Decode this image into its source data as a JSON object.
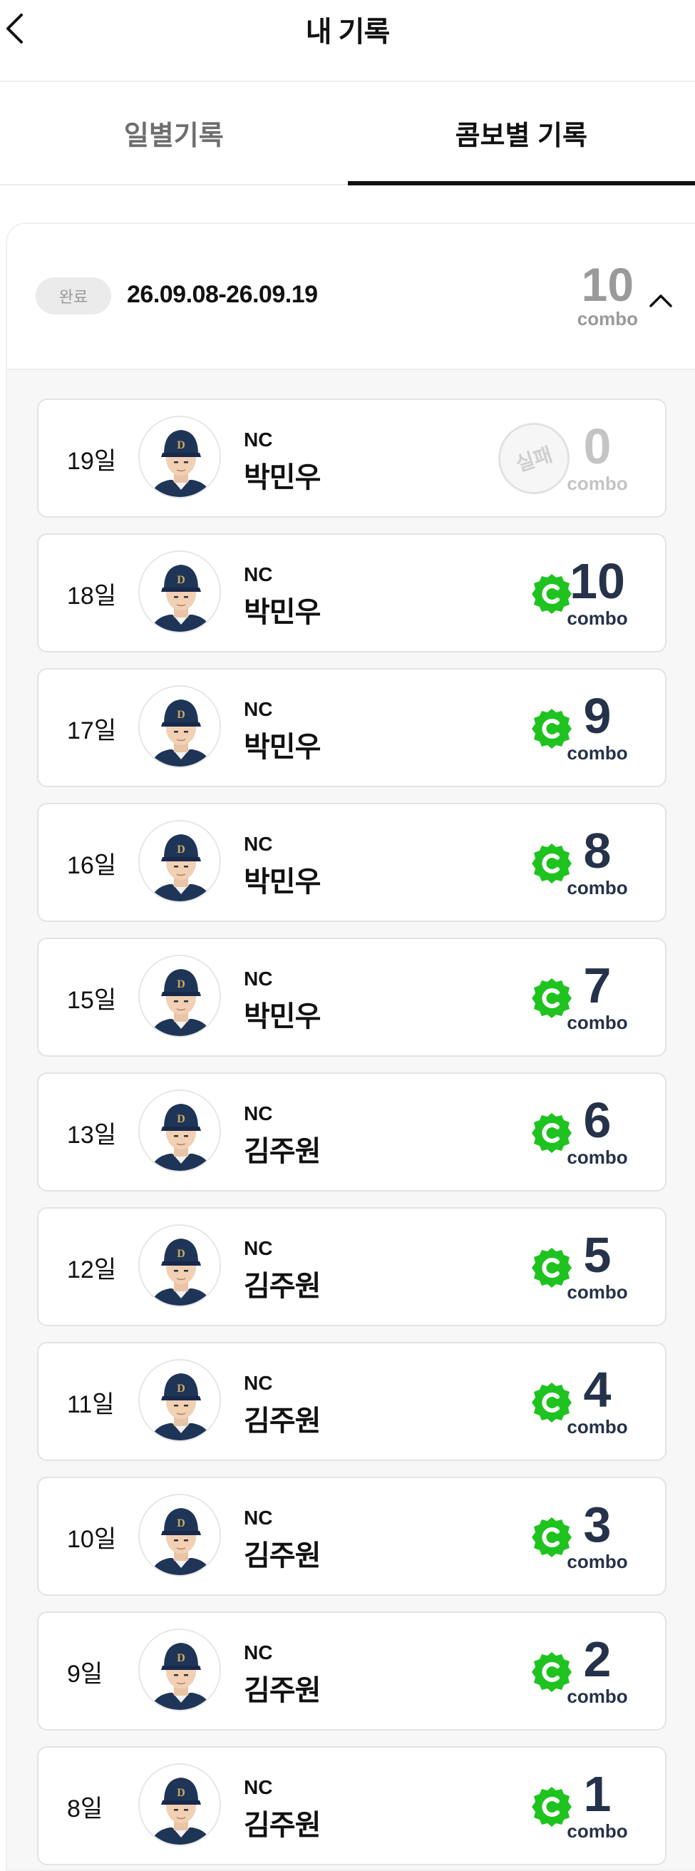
{
  "header": {
    "title": "내 기록"
  },
  "tabs": [
    {
      "label": "일별기록",
      "active": false
    },
    {
      "label": "콤보별 기록",
      "active": true
    }
  ],
  "period": {
    "status": "완료",
    "range": "26.09.08-26.09.19",
    "total_combo": "10",
    "combo_label": "combo"
  },
  "records": [
    {
      "day": "19일",
      "team": "NC",
      "player": "박민우",
      "success": false,
      "fail_label": "실패",
      "combo": "0",
      "combo_label": "combo"
    },
    {
      "day": "18일",
      "team": "NC",
      "player": "박민우",
      "success": true,
      "combo": "10",
      "combo_label": "combo"
    },
    {
      "day": "17일",
      "team": "NC",
      "player": "박민우",
      "success": true,
      "combo": "9",
      "combo_label": "combo"
    },
    {
      "day": "16일",
      "team": "NC",
      "player": "박민우",
      "success": true,
      "combo": "8",
      "combo_label": "combo"
    },
    {
      "day": "15일",
      "team": "NC",
      "player": "박민우",
      "success": true,
      "combo": "7",
      "combo_label": "combo"
    },
    {
      "day": "13일",
      "team": "NC",
      "player": "김주원",
      "success": true,
      "combo": "6",
      "combo_label": "combo"
    },
    {
      "day": "12일",
      "team": "NC",
      "player": "김주원",
      "success": true,
      "combo": "5",
      "combo_label": "combo"
    },
    {
      "day": "11일",
      "team": "NC",
      "player": "김주원",
      "success": true,
      "combo": "4",
      "combo_label": "combo"
    },
    {
      "day": "10일",
      "team": "NC",
      "player": "김주원",
      "success": true,
      "combo": "3",
      "combo_label": "combo"
    },
    {
      "day": "9일",
      "team": "NC",
      "player": "김주원",
      "success": true,
      "combo": "2",
      "combo_label": "combo"
    },
    {
      "day": "8일",
      "team": "NC",
      "player": "김주원",
      "success": true,
      "combo": "1",
      "combo_label": "combo"
    }
  ],
  "colors": {
    "success": "#1fc31f",
    "combo_text": "#26324a",
    "fail_text": "#c4c4c4",
    "cap": "#1f3557"
  }
}
